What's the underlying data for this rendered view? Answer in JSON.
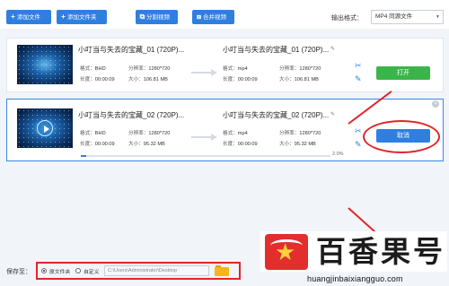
{
  "toolbar": {
    "add_file": "添加文件",
    "add_folder": "添加文件夹",
    "split_video": "分割视频",
    "merge_video": "合并视频",
    "output_format_label": "输出格式：",
    "output_format_value": "MP4 同源文件"
  },
  "rows": [
    {
      "src_title": "小叮当与失去的宝藏_01 (720P)...",
      "dst_title": "小叮当与失去的宝藏_01 (720P)...",
      "src_format_k": "格式：",
      "src_format_v": "BHD",
      "src_res_k": "分辨率：",
      "src_res_v": "1280*720",
      "src_dur_k": "长度：",
      "src_dur_v": "00:00:09",
      "src_size_k": "大小：",
      "src_size_v": "106.81 MB",
      "dst_format_k": "格式：",
      "dst_format_v": "mp4",
      "dst_res_k": "分辨率：",
      "dst_res_v": "1280*720",
      "dst_dur_k": "长度：",
      "dst_dur_v": "00:00:09",
      "dst_size_k": "大小：",
      "dst_size_v": "106.81 MB",
      "action": "打开"
    },
    {
      "src_title": "小叮当与失去的宝藏_02 (720P)...",
      "dst_title": "小叮当与失去的宝藏_02 (720P)...",
      "src_format_k": "格式：",
      "src_format_v": "BHD",
      "src_res_k": "分辨率：",
      "src_res_v": "1280*720",
      "src_dur_k": "长度：",
      "src_dur_v": "00:00:09",
      "src_size_k": "大小：",
      "src_size_v": "95.32 MB",
      "dst_format_k": "格式：",
      "dst_format_v": "mp4",
      "dst_res_k": "分辨率：",
      "dst_res_v": "1280*720",
      "dst_dur_k": "长度：",
      "dst_dur_v": "00:00:09",
      "dst_size_k": "大小：",
      "dst_size_v": "95.32 MB",
      "action": "取消",
      "progress": 0.02,
      "progress_text": "2.0%"
    }
  ],
  "save": {
    "label": "保存至：",
    "option_source": "原文件夹",
    "option_custom": "自定义",
    "path": "C:\\Users\\Administrator\\Desktop"
  },
  "watermark": {
    "brand": "百香果号",
    "url": "huangjinbaixiangguo.com"
  },
  "colors": {
    "accent": "#2f7fe0",
    "open_button": "#3bb54a",
    "annotation": "#e0262b"
  },
  "icons": [
    "plus-icon",
    "plus-icon",
    "split-icon",
    "merge-icon",
    "scissors-icon",
    "edit-icon",
    "close-icon",
    "folder-icon"
  ]
}
